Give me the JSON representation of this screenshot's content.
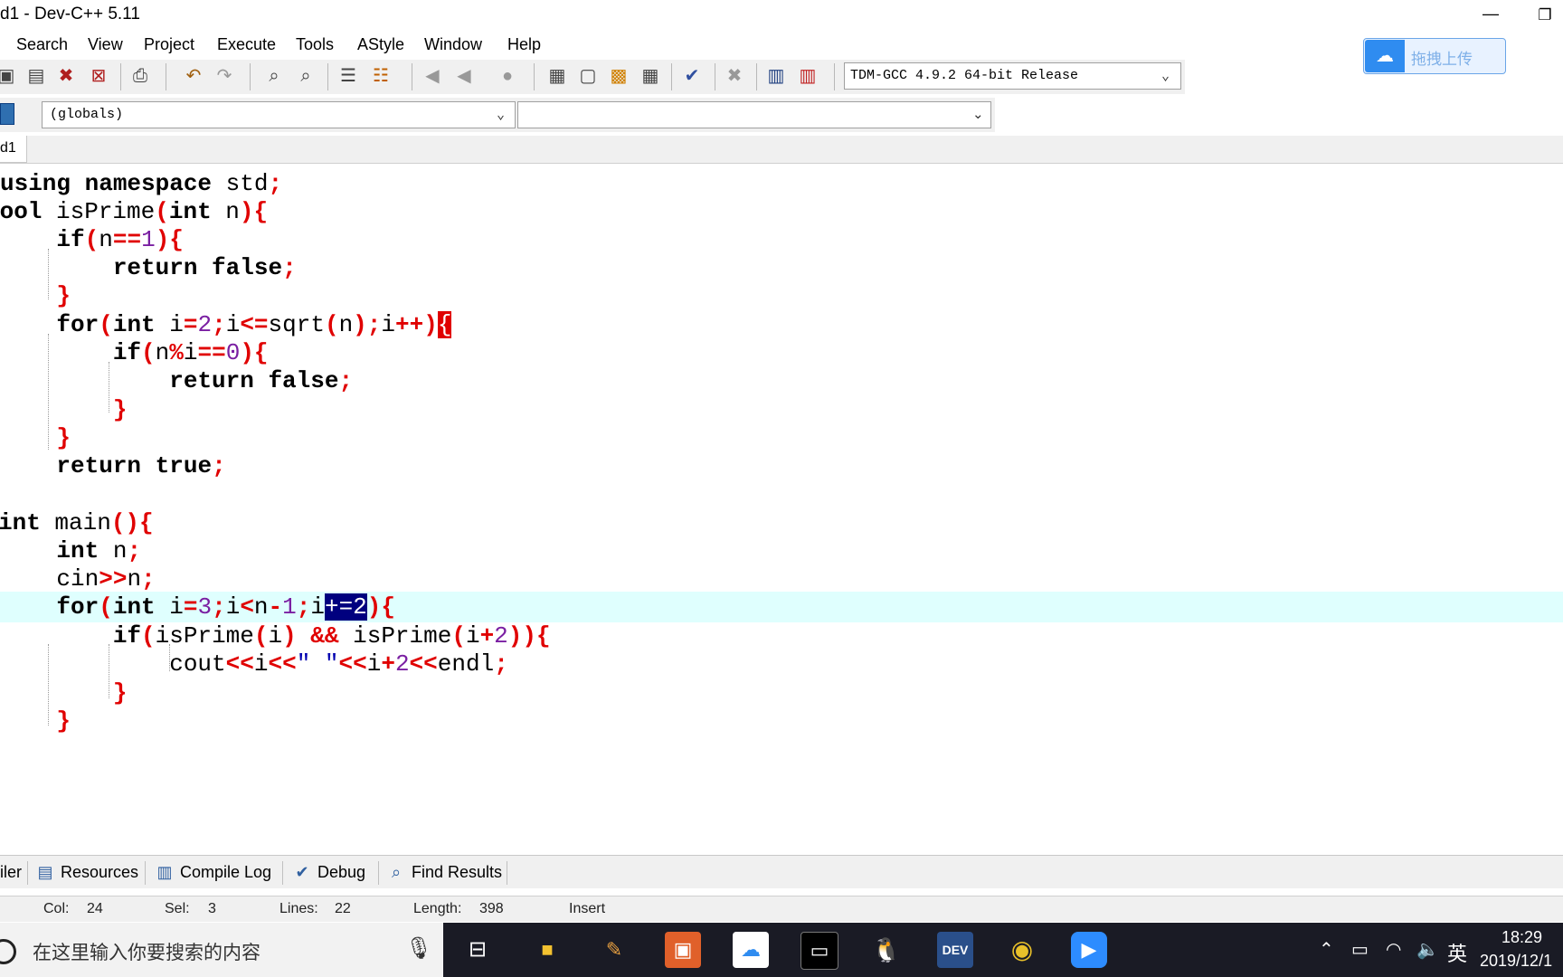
{
  "window": {
    "title": "d1 - Dev-C++ 5.11",
    "minimize_glyph": "—",
    "restore_glyph": "❐"
  },
  "menu": [
    "Search",
    "View",
    "Project",
    "Execute",
    "Tools",
    "AStyle",
    "Window",
    "Help"
  ],
  "cloud_widget": {
    "label": "拖拽上传",
    "icon": "baidu-cloud-icon"
  },
  "toolbar": {
    "compiler": "TDM-GCC 4.9.2 64-bit Release",
    "icons": [
      "save-icon",
      "save-all-icon",
      "close-icon",
      "close-all-icon",
      "print-icon",
      "undo-icon",
      "redo-icon",
      "find-icon",
      "replace-icon",
      "indent-icon",
      "unindent-icon",
      "goto-back-icon",
      "goto-forward-icon",
      "bookmark-icon",
      "new-class-icon",
      "new-window-icon",
      "project-options-icon",
      "layout-icon",
      "check-icon",
      "delete-icon",
      "chart-icon",
      "profile-icon"
    ]
  },
  "classbar": {
    "scope": "(globals)",
    "members": ""
  },
  "file_tab": {
    "label": "d1"
  },
  "code": {
    "lines": [
      "using namespace std;",
      "bool isPrime(int n){",
      "    if(n==1){",
      "        return false;",
      "    }",
      "    for(int i=2;i<=sqrt(n);i++){",
      "        if(n%i==0){",
      "            return false;",
      "        }",
      "    }",
      "    return true;",
      "}",
      "int main(){",
      "    int n;",
      "    cin>>n;",
      "    for(int i=3;i<n-1;i+=2){",
      "        if(isPrime(i) && isPrime(i+2)){",
      "            cout<<i<<\" \"<<i+2<<endl;",
      "        }",
      "    }",
      "}"
    ],
    "active_line": 16,
    "selected_text": "+=2"
  },
  "bottom_tabs": [
    "iler",
    "Resources",
    "Compile Log",
    "Debug",
    "Find Results"
  ],
  "status": {
    "col_label": "Col:",
    "col": "24",
    "sel_label": "Sel:",
    "sel": "3",
    "lines_label": "Lines:",
    "lines": "22",
    "length_label": "Length:",
    "length": "398",
    "mode": "Insert"
  },
  "taskbar": {
    "search_placeholder": "在这里输入你要搜索的内容",
    "ime": "英",
    "time": "18:29",
    "date": "2019/12/1"
  }
}
